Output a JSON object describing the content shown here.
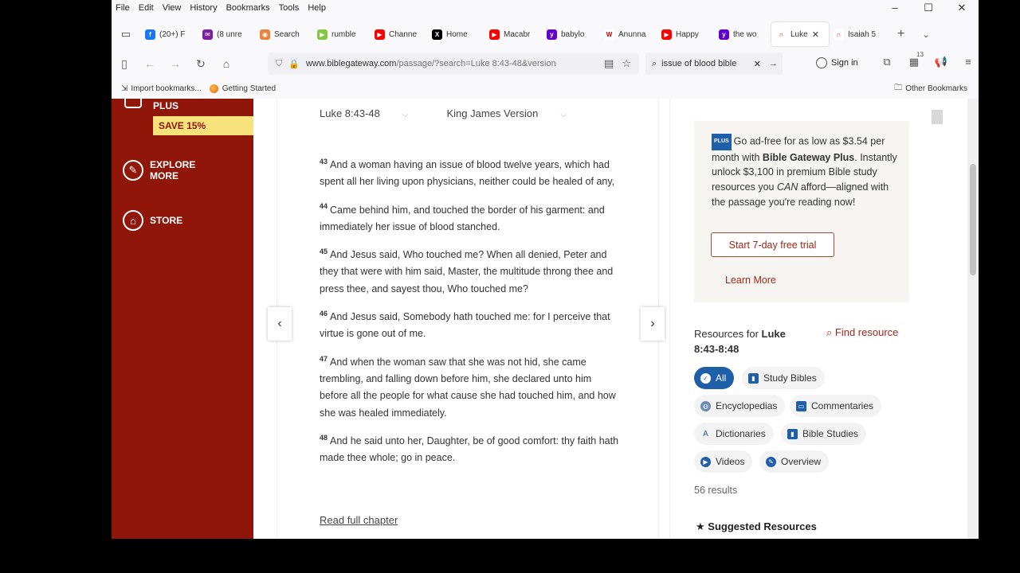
{
  "menu": [
    "File",
    "Edit",
    "View",
    "History",
    "Bookmarks",
    "Tools",
    "Help"
  ],
  "window_controls": [
    "–",
    "☐",
    "✕"
  ],
  "tabs": [
    {
      "label": "(20+) F",
      "color": "#1877f2",
      "glyph": "f"
    },
    {
      "label": "(8 unre",
      "color": "#7b1fa2",
      "glyph": "✉"
    },
    {
      "label": "Search",
      "color": "#e8843b",
      "glyph": "◉"
    },
    {
      "label": "rumble",
      "color": "#85c742",
      "glyph": "▶"
    },
    {
      "label": "Channe",
      "color": "#ff0000",
      "glyph": "▶"
    },
    {
      "label": "Home",
      "color": "#000000",
      "glyph": "X"
    },
    {
      "label": "Macabr",
      "color": "#ff0000",
      "glyph": "▶"
    },
    {
      "label": "babylo",
      "color": "#6001d2",
      "glyph": "y"
    },
    {
      "label": "Anunna",
      "color": "#ffffff",
      "glyph": "W"
    },
    {
      "label": "Happy",
      "color": "#ff0000",
      "glyph": "▶"
    },
    {
      "label": "the wo",
      "color": "#6001d2",
      "glyph": "y"
    },
    {
      "label": "Luke",
      "color": "#ffffff",
      "glyph": "∩",
      "active": true
    },
    {
      "label": "Isaiah 5",
      "color": "#ffffff",
      "glyph": "∩"
    }
  ],
  "tab_close": "✕",
  "new_tab": "+",
  "url": {
    "domain": "www.biblegateway.com",
    "path": "/passage/?search=Luke 8:43-48&version"
  },
  "search": {
    "query": "issue of blood bible",
    "clear": "✕",
    "go": "→"
  },
  "sign_in": "Sign in",
  "extension_badge": "13",
  "bookmarks": {
    "import": "Import bookmarks...",
    "getting_started": "Getting Started",
    "other": "Other Bookmarks"
  },
  "sidebar": {
    "plus": "PLUS",
    "save": "SAVE 15%",
    "explore": [
      "EXPLORE",
      "MORE"
    ],
    "store": "STORE"
  },
  "passage": {
    "reference": "Luke 8:43-48",
    "version": "King James Version",
    "verses": [
      {
        "num": "43",
        "text": "And a woman having an issue of blood twelve years, which had spent all her living upon physicians, neither could be healed of any,"
      },
      {
        "num": "44",
        "text": "Came behind him, and touched the border of his garment: and immediately her issue of blood stanched."
      },
      {
        "num": "45",
        "text": "And Jesus said, Who touched me? When all denied, Peter and they that were with him said, Master, the multitude throng thee and press thee, and sayest thou, Who touched me?"
      },
      {
        "num": "46",
        "text": "And Jesus said, Somebody hath touched me: for I perceive that virtue is gone out of me."
      },
      {
        "num": "47",
        "text": "And when the woman saw that she was not hid, she came trembling, and falling down before him, she declared unto him before all the people for what cause she had touched him, and how she was healed immediately."
      },
      {
        "num": "48",
        "text": "And he said unto her, Daughter, be of good comfort: thy faith hath made thee whole; go in peace."
      }
    ],
    "read_full": "Read full chapter",
    "prev": "‹",
    "next": "›"
  },
  "promo": {
    "badge": "PLUS",
    "text_a": "Go ad-free for as low as $3.54 per month with ",
    "text_bold": "Bible Gateway Plus",
    "text_b": ". Instantly unlock $3,100 in premium Bible study resources you ",
    "text_em": "CAN",
    "text_c": " afford—aligned with the passage you're reading now!",
    "trial": "Start 7-day free trial",
    "learn": "Learn More"
  },
  "resources": {
    "prefix": "Resources for ",
    "ref": "Luke 8:43-8:48",
    "find": "Find resource",
    "chips": [
      "All",
      "Study Bibles",
      "Encyclopedias",
      "Commentaries",
      "Dictionaries",
      "Bible Studies",
      "Videos",
      "Overview"
    ],
    "results": "56 results",
    "suggested": "Suggested Resources"
  },
  "colors": {
    "sidebar": "#8f1608",
    "accent": "#a0271a",
    "chip_active": "#1f5ea8"
  }
}
